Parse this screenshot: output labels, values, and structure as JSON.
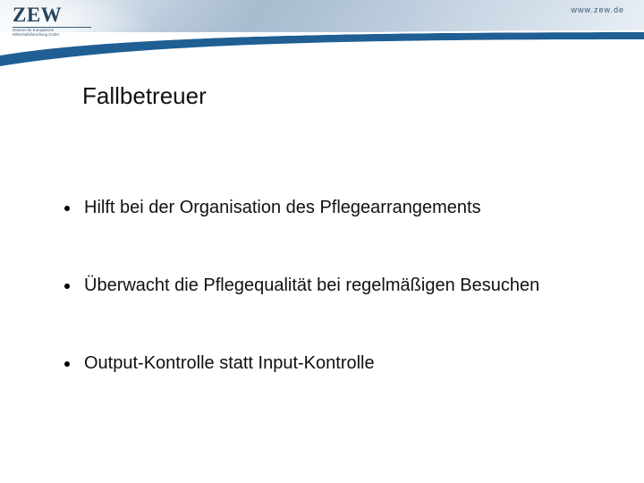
{
  "header": {
    "logo_text": "ZEW",
    "logo_subtitle": "Zentrum für Europäische\nWirtschaftsforschung GmbH",
    "url": "www.zew.de"
  },
  "title": "Fallbetreuer",
  "bullets": [
    "Hilft bei der Organisation des Pflegearrangements",
    "Überwacht die Pflegequalität bei regelmäßigen Besuchen",
    "Output-Kontrolle statt Input-Kontrolle"
  ]
}
